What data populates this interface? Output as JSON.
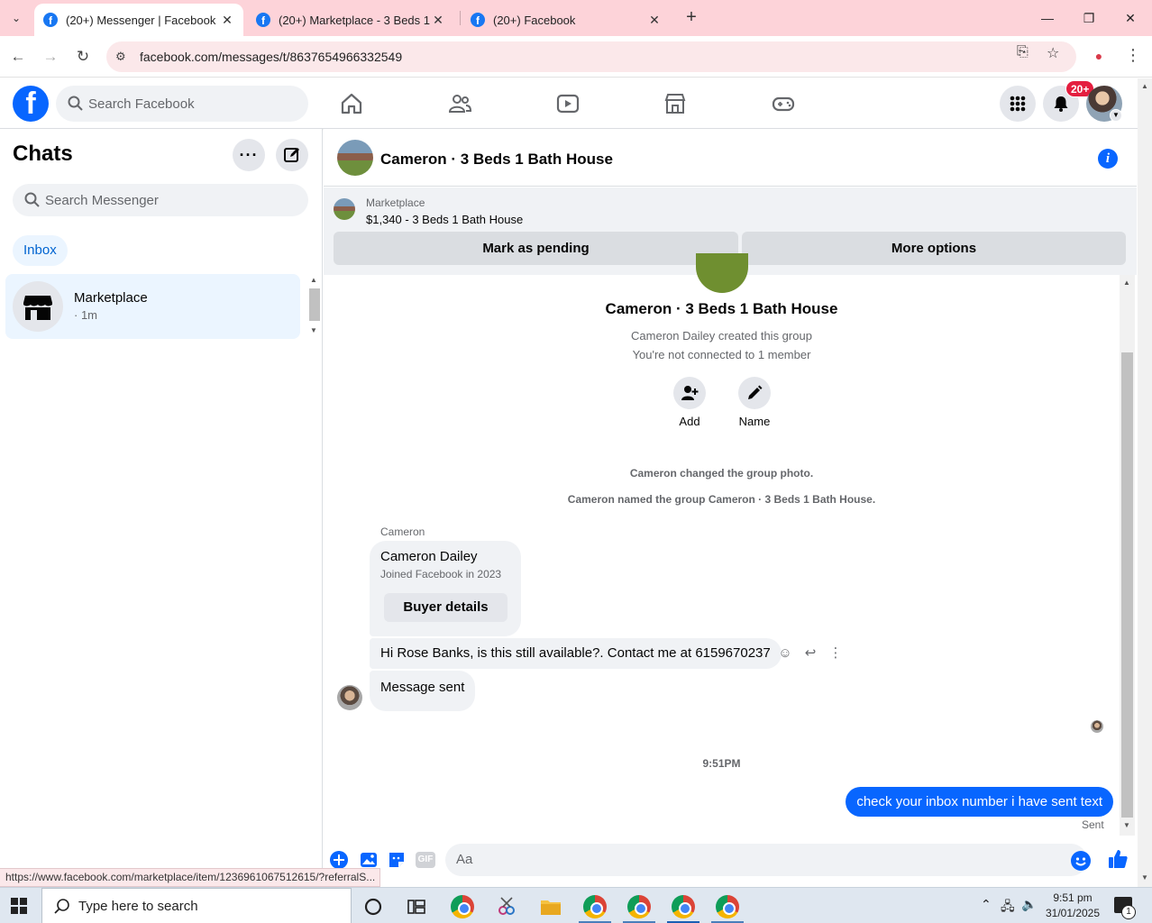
{
  "browser": {
    "tabs": [
      {
        "title": "(20+) Messenger | Facebook",
        "active": true
      },
      {
        "title": "(20+) Marketplace - 3 Beds 1 Bath House",
        "active": false
      },
      {
        "title": "(20+) Facebook",
        "active": false
      }
    ],
    "url": "facebook.com/messages/t/8637654966332549",
    "status_url": "https://www.facebook.com/marketplace/item/1236961067512615/?referralS..."
  },
  "facebook": {
    "logo": "f",
    "search_placeholder": "Search Facebook",
    "notification_badge": "20+",
    "nav_icons": [
      "home-icon",
      "friends-icon",
      "watch-icon",
      "marketplace-icon",
      "gaming-icon"
    ]
  },
  "sidebar": {
    "title": "Chats",
    "search_placeholder": "Search Messenger",
    "filter": "Inbox",
    "chats": [
      {
        "name": "Marketplace",
        "meta": "· 1m"
      }
    ]
  },
  "conversation": {
    "title": "Cameron · 3 Beds 1 Bath House",
    "marketplace_label": "Marketplace",
    "listing": "$1,340 - 3 Beds 1 Bath House",
    "mark_pending": "Mark as pending",
    "more_options": "More options",
    "group_name": "Cameron · 3 Beds 1 Bath House",
    "created_by": "Cameron Dailey created this group",
    "connection": "You're not connected to 1 member",
    "actions": {
      "add": "Add",
      "name": "Name"
    },
    "system_messages": [
      "Cameron changed the group photo.",
      "Cameron named the group Cameron · 3 Beds 1 Bath House."
    ],
    "sender": "Cameron",
    "card": {
      "name": "Cameron Dailey",
      "joined": "Joined Facebook in 2023",
      "button": "Buyer details"
    },
    "incoming_message": "Hi Rose Banks, is this still available?. Contact me at 6159670237",
    "message_sent": "Message sent",
    "timestamp": "9:51PM",
    "outgoing_message": "check your inbox number i have sent text",
    "sent_status": "Sent",
    "composer_placeholder": "Aa",
    "gif_label": "GIF"
  },
  "taskbar": {
    "search_placeholder": "Type here to search",
    "time": "9:51 pm",
    "date": "31/01/2025",
    "notification_count": "1"
  },
  "colors": {
    "facebook_blue": "#0866ff",
    "tab_bar": "#fdd3d9",
    "badge_red": "#e41e3f"
  }
}
